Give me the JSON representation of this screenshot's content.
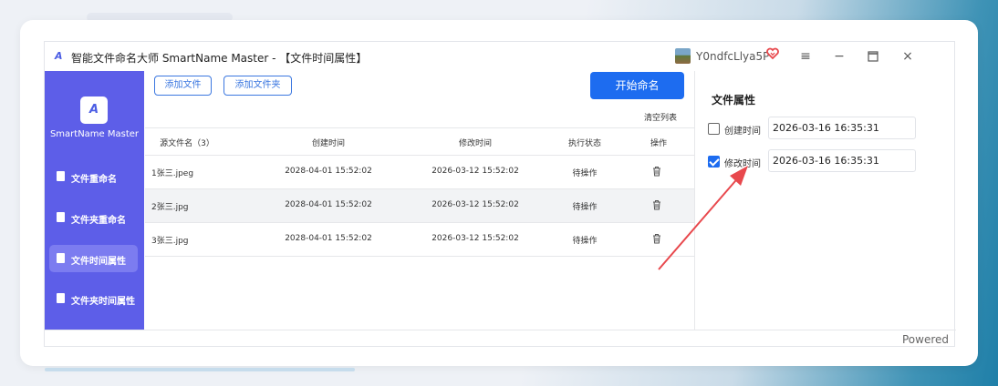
{
  "window": {
    "title": "智能文件命名大师 SmartName Master - 【文件时间属性】",
    "username": "Y0ndfcLlya5P",
    "app_icon": "A"
  },
  "sidebar": {
    "logo_text": "SmartName Master",
    "items": [
      {
        "label": "文件重命名",
        "active": false
      },
      {
        "label": "文件夹重命名",
        "active": false
      },
      {
        "label": "文件时间属性",
        "active": true
      },
      {
        "label": "文件夹时间属性",
        "active": false
      }
    ]
  },
  "toolbar": {
    "add_file": "添加文件",
    "add_folder": "添加文件夹",
    "start": "开始命名",
    "clear": "清空列表"
  },
  "table": {
    "headers": [
      "源文件名（3）",
      "创建时间",
      "修改时间",
      "执行状态",
      "操作"
    ],
    "rows": [
      {
        "name": "1张三.jpeg",
        "created": "2028-04-01 15:52:02",
        "modified": "2026-03-12 15:52:02",
        "status": "待操作"
      },
      {
        "name": "2张三.jpg",
        "created": "2028-04-01 15:52:02",
        "modified": "2026-03-12 15:52:02",
        "status": "待操作"
      },
      {
        "name": "3张三.jpg",
        "created": "2028-04-01 15:52:02",
        "modified": "2026-03-12 15:52:02",
        "status": "待操作"
      }
    ]
  },
  "properties": {
    "title": "文件属性",
    "created": {
      "label": "创建时间",
      "value": "2026-03-16 16:35:31",
      "checked": false
    },
    "modified": {
      "label": "修改时间",
      "value": "2026-03-16 16:35:31",
      "checked": true
    }
  },
  "footer": {
    "powered": "Powered"
  },
  "colors": {
    "accent": "#5d5ee8",
    "primary": "#1d6cf0",
    "arrow": "#e8484d"
  }
}
